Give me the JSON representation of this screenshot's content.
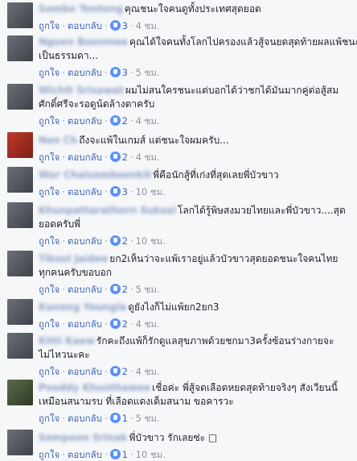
{
  "like_label": "ถูกใจ",
  "reply_label": "ตอบกลับ",
  "comments": [
    {
      "author": "Sombo Tontong",
      "text_lines": [
        "คุณชนะใจคนดูทั้งประเทศสุดยอด"
      ],
      "likes": "3",
      "time": "4 ชม."
    },
    {
      "author": "Nguen Boonmee",
      "text_lines": [
        "คุณได้ใจคนทั้งโลกไปครองแล้วสู้จนยดสุดท้ายผลแพ้ชนะ",
        "เป็นธรรมดา..."
      ],
      "likes": "3",
      "time": "5 ชม."
    },
    {
      "author": "Wichit Srisawat",
      "text_lines": [
        "ผมไม่สนใครชนะแต่บอกได้ว่าชกได้มันมากคู่ต่อสู้สม",
        "ศักดิ์ศรีจะรอดูน้ดล้างตาครับ"
      ],
      "likes": "2",
      "time": "4 ชม."
    },
    {
      "author": "Nan Ch",
      "text_lines": [
        "ถึงจะแพ้ในเกมส์ แต่ชนะใจผมครับ..."
      ],
      "likes": "2",
      "time": "4 ชม."
    },
    {
      "author": "Wor Chaisomboonkit",
      "text_lines": [
        "พี่คือนักสู้ที่เก่งที่สุดเลยพี่บัวขาว"
      ],
      "likes": "3",
      "time": "10 ชม."
    },
    {
      "author": "Khunpattarathorn Suksai",
      "text_lines": [
        "โลกได้รู้พิษสงมวยไทยและพี่บัวขาว....สุด",
        "ยอดครับพี่"
      ],
      "likes": "2",
      "time": "10 ชม."
    },
    {
      "author": "Tikool Jaidee",
      "text_lines": [
        "ยก2เห็นว่าจะแพ้เราอยู่แล้วบัวขาวสุดยอดชนะใจคนไทย",
        "ทุกคนครับขอบอก"
      ],
      "likes": "2",
      "time": "5 ชม."
    },
    {
      "author": "Kanong Youngla",
      "text_lines": [
        "ดูยังไงก็ไม่แพ้ยก2ยก3"
      ],
      "likes": "2",
      "time": "4 ชม."
    },
    {
      "author": "Kitti Kaew",
      "text_lines": [
        "รักคะถึงแพ้ก็รักดูแลสุขภาพด้วยชกมา3ครั้งซ้อนร่างกายจะ",
        "ไม่ไหวนะคะ"
      ],
      "likes": "2",
      "time": "4 ชม."
    },
    {
      "author": "Pooddy Khunthawee",
      "text_lines": [
        "เชื่อค่ะ พี่สู้จดเลือดหยดสุดท้ายจริงๆ สังเวียนนี้",
        "เหมือนสนามรบ ที่เลือดแดงเต็มสนาม ขอคารวะ"
      ],
      "likes": "1",
      "time": "5 ชม."
    },
    {
      "author": "Sompoon Srinak",
      "text_lines": [
        "พี่บัวขาว รักเลยซ่ะ □"
      ],
      "likes": "1",
      "time": "10 ชม."
    }
  ]
}
